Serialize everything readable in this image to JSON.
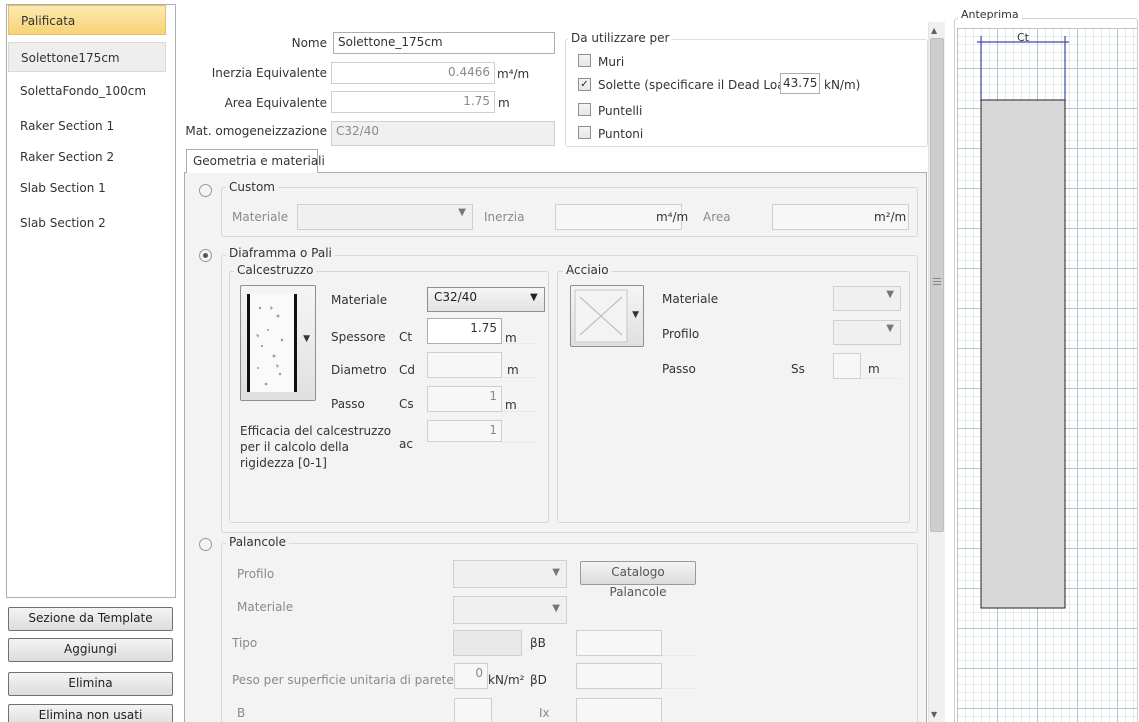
{
  "sidebar": {
    "items": [
      "Palificata",
      "Solettone175cm",
      "SolettaFondo_100cm",
      "Raker Section 1",
      "Raker Section 2",
      "Slab Section 1",
      "Slab Section 2"
    ],
    "buttons": [
      "Sezione da Template",
      "Aggiungi",
      "Elimina",
      "Elimina non usati"
    ]
  },
  "header": {
    "nome_label": "Nome",
    "nome_value": "Solettone_175cm",
    "inerzia_label": "Inerzia Equivalente",
    "inerzia_value": "0.4466",
    "inerzia_unit": "m⁴/m",
    "area_label": "Area Equivalente",
    "area_value": "1.75",
    "area_unit": "m",
    "mat_label": "Mat. omogeneizzazione",
    "mat_value": "C32/40"
  },
  "usage": {
    "title": "Da utilizzare per",
    "muri": "Muri",
    "solette": "Solette  (specificare il Dead Load",
    "dead_load_value": "43.75",
    "dead_load_unit": "kN/m)",
    "puntelli": "Puntelli",
    "puntoni": "Puntoni"
  },
  "tab": {
    "label": "Geometria e materiali"
  },
  "custom": {
    "title": "Custom",
    "materiale_label": "Materiale",
    "inerzia_label": "Inerzia",
    "inerzia_unit": "m⁴/m",
    "area_label": "Area",
    "area_unit": "m²/m"
  },
  "diaframma": {
    "title": "Diaframma o Pali",
    "calcestruzzo": {
      "title": "Calcestruzzo",
      "materiale_label": "Materiale",
      "materiale_value": "C32/40",
      "spessore_label": "Spessore",
      "spessore_sym": "Ct",
      "spessore_value": "1.75",
      "spessore_unit": "m",
      "diametro_label": "Diametro",
      "diametro_sym": "Cd",
      "diametro_unit": "m",
      "passo_label": "Passo",
      "passo_sym": "Cs",
      "passo_value": "1",
      "passo_unit": "m",
      "efficacia_line1": "Efficacia del calcestruzzo",
      "efficacia_line2": "per il calcolo della",
      "efficacia_line3": "rigidezza  [0-1]",
      "efficacia_sym": "ac",
      "efficacia_value": "1"
    },
    "acciaio": {
      "title": "Acciaio",
      "materiale_label": "Materiale",
      "profilo_label": "Profilo",
      "passo_label": "Passo",
      "passo_sym": "Ss",
      "passo_unit": "m"
    }
  },
  "palancole": {
    "title": "Palancole",
    "profilo_label": "Profilo",
    "catalogo_button": "Catalogo Palancole",
    "materiale_label": "Materiale",
    "tipo_label": "Tipo",
    "beta_b": "βB",
    "peso_label": "Peso per superficie unitaria di parete",
    "peso_value": "0",
    "peso_unit": "kN/m²",
    "beta_d": "βD",
    "b_label": "B",
    "ix_label": "Ix"
  },
  "preview": {
    "title": "Anteprima",
    "dimension_label": "Ct"
  }
}
